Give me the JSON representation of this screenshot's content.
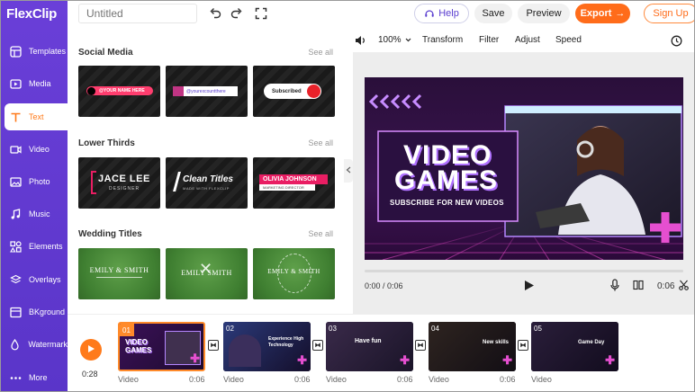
{
  "app": {
    "logo": "FlexClip"
  },
  "sidebar": {
    "items": [
      {
        "label": "Templates",
        "icon": "templates-icon"
      },
      {
        "label": "Media",
        "icon": "media-icon"
      },
      {
        "label": "Text",
        "icon": "text-icon",
        "active": true
      },
      {
        "label": "Video",
        "icon": "video-icon"
      },
      {
        "label": "Photo",
        "icon": "photo-icon"
      },
      {
        "label": "Music",
        "icon": "music-icon"
      },
      {
        "label": "Elements",
        "icon": "elements-icon"
      },
      {
        "label": "Overlays",
        "icon": "overlays-icon"
      },
      {
        "label": "BKground",
        "icon": "background-icon"
      },
      {
        "label": "Watermark",
        "icon": "watermark-icon"
      },
      {
        "label": "More",
        "icon": "more-icon"
      }
    ]
  },
  "topbar": {
    "title_placeholder": "Untitled",
    "help_label": "Help",
    "save_label": "Save",
    "preview_label": "Preview",
    "export_label": "Export",
    "signup_label": "Sign Up"
  },
  "panel": {
    "sections": [
      {
        "title": "Social Media",
        "see_all": "See all",
        "items": [
          {
            "text": "@YOUR NAME HERE"
          },
          {
            "text": "@yourexcountthere"
          },
          {
            "text": "Subscribed"
          }
        ]
      },
      {
        "title": "Lower Thirds",
        "see_all": "See all",
        "items": [
          {
            "title": "JACE LEE",
            "subtitle": "DESIGNER"
          },
          {
            "title": "Clean Titles",
            "subtitle": "MADE WITH FLEXCLIP"
          },
          {
            "title": "OLIVIA JOHNSON",
            "subtitle": "MARKETING DIRECTOR"
          }
        ]
      },
      {
        "title": "Wedding Titles",
        "see_all": "See all",
        "items": [
          {
            "title": "EMILY & SMITH"
          },
          {
            "title": "EMILY SMITH"
          },
          {
            "title": "EMILY & SMITH"
          }
        ]
      }
    ]
  },
  "edit_toolbar": {
    "zoom": "100%",
    "items": [
      "Transform",
      "Filter",
      "Adjust",
      "Speed"
    ]
  },
  "preview": {
    "headline_line1": "VIDEO",
    "headline_line2": "GAMES",
    "subline": "SUBSCRIBE FOR NEW VIDEOS",
    "time_current": "0:00 / 0:06",
    "duration": "0:06",
    "progress": 0
  },
  "timeline": {
    "time": "0:28",
    "clips": [
      {
        "num": "01",
        "label": "Video",
        "duration": "0:06",
        "caption": "VIDEO GAMES",
        "selected": true
      },
      {
        "num": "02",
        "label": "Video",
        "duration": "0:06",
        "caption": "Experience High Technology"
      },
      {
        "num": "03",
        "label": "Video",
        "duration": "0:06",
        "caption": "Have fun"
      },
      {
        "num": "04",
        "label": "Video",
        "duration": "0:06",
        "caption": "New skills"
      },
      {
        "num": "05",
        "label": "Video",
        "duration": "",
        "caption": "Game Day"
      }
    ]
  },
  "colors": {
    "sidebar": "#6a3fd8",
    "accent": "#ff6c1a",
    "help_text": "#5b3fd0"
  }
}
